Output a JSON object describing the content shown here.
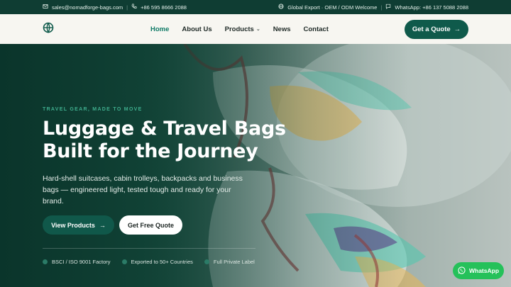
{
  "topbar": {
    "email": "sales@nomadforge-bags.com",
    "phone": "+86 595 8666 2088",
    "tagline": "Global Export · OEM / ODM Welcome",
    "whatsapp": "WhatsApp: +86 137 5088 2088"
  },
  "nav": {
    "items": [
      {
        "label": "Home"
      },
      {
        "label": "About Us"
      },
      {
        "label": "Products"
      },
      {
        "label": "News"
      },
      {
        "label": "Contact"
      }
    ],
    "cta_label": "Get a Quote"
  },
  "hero": {
    "eyebrow": "TRAVEL GEAR, MADE TO MOVE",
    "title_line1": "Luggage & Travel Bags",
    "title_line2": "Built for the Journey",
    "lead": "Hard-shell suitcases, cabin trolleys, backpacks and business bags — engineered light, tested tough and ready for your brand.",
    "primary_button": "View Products",
    "secondary_button": "Get Free Quote",
    "badges": [
      {
        "label": "BSCI / ISO 9001 Factory"
      },
      {
        "label": "Exported to 50+ Countries"
      },
      {
        "label": "Full Private Label"
      }
    ]
  },
  "floating": {
    "whatsapp_label": "WhatsApp"
  },
  "colors": {
    "brand_dark": "#0f3d33",
    "brand": "#0f5a4b",
    "accent": "#3fae8e",
    "whatsapp": "#25c15a"
  }
}
